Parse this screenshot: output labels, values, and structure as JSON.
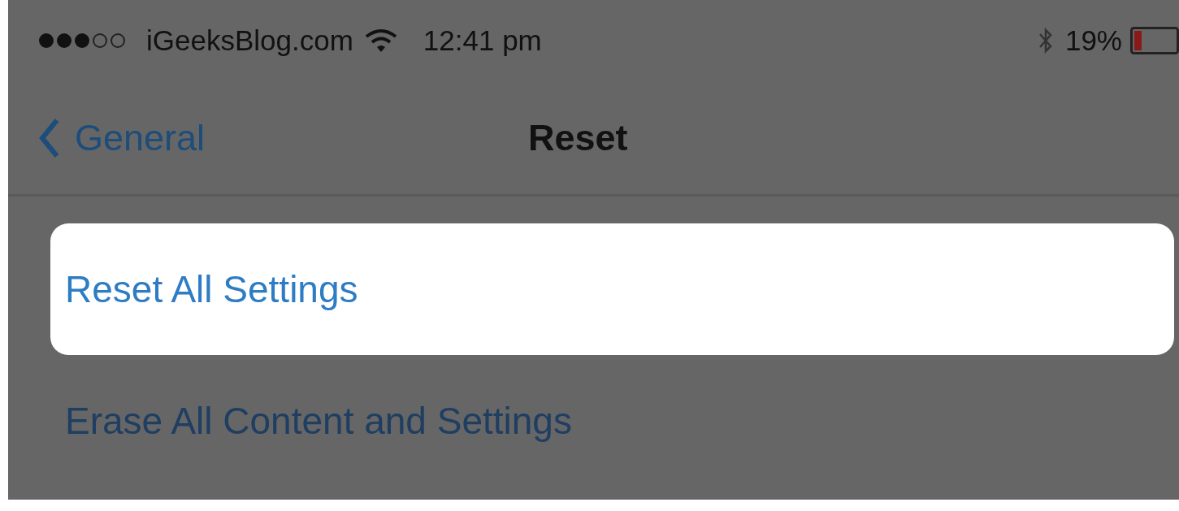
{
  "status_bar": {
    "carrier": "iGeeksBlog.com",
    "time": "12:41 pm",
    "battery": "19%"
  },
  "nav": {
    "back": "General",
    "title": "Reset"
  },
  "rows": [
    {
      "label": "Reset All Settings",
      "selected": true
    },
    {
      "label": "Erase All Content and Settings",
      "selected": false
    }
  ]
}
